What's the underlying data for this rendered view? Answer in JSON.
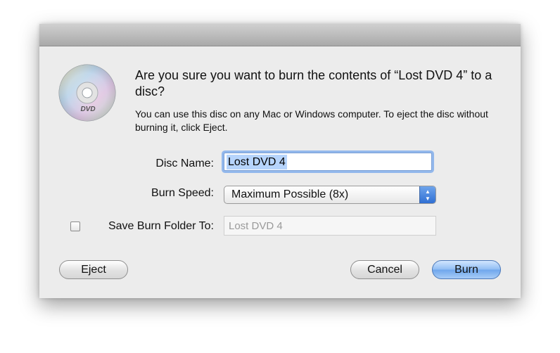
{
  "dialog": {
    "headline": "Are you sure you want to burn the contents of “Lost DVD 4” to a disc?",
    "message": "You can use this disc on any Mac or Windows computer. To eject the disc without burning it, click Eject.",
    "icon": "dvd-disc-icon",
    "icon_text": "DVD"
  },
  "form": {
    "disc_name_label": "Disc Name:",
    "disc_name_value": "Lost DVD 4",
    "burn_speed_label": "Burn Speed:",
    "burn_speed_value": "Maximum Possible (8x)",
    "save_folder_label": "Save Burn Folder To:",
    "save_folder_checked": false,
    "save_folder_placeholder": "Lost DVD 4"
  },
  "buttons": {
    "eject": "Eject",
    "cancel": "Cancel",
    "burn": "Burn"
  },
  "colors": {
    "default_button": "#8fbcf3",
    "focus_ring": "#93b8ec",
    "text_selection": "#b6d4fc",
    "dialog_background": "#ececec"
  }
}
